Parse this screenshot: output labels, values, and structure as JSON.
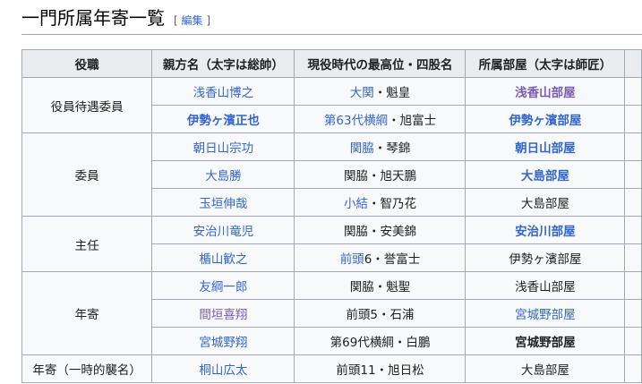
{
  "section": {
    "title": "一門所属年寄一覧",
    "edit_open": "[ ",
    "edit_label": "編集",
    "edit_close": " ]"
  },
  "table": {
    "headers": [
      "役職",
      "親方名（太字は総帥）",
      "現役時代の最高位・四股名",
      "所属部屋（太字は師匠）"
    ],
    "roles": {
      "r1": "役員待遇委員",
      "r2": "委員",
      "r3": "主任",
      "r4": "年寄",
      "r5": "年寄（一時的襲名）"
    },
    "rows": [
      {
        "name": "浅香山博之",
        "rank_link": "大関",
        "rank_rest": "・魁皇",
        "stable": "浅香山部屋"
      },
      {
        "name": "伊勢ヶ濱正也",
        "rank_link": "第63代横綱",
        "rank_rest": "・旭富士",
        "stable": "伊勢ヶ濱部屋"
      },
      {
        "name": "朝日山宗功",
        "rank_link": "関脇",
        "rank_rest": "・琴錦",
        "stable": "朝日山部屋"
      },
      {
        "name": "大島勝",
        "rank": "関脇・旭天鵬",
        "stable": "大島部屋"
      },
      {
        "name": "玉垣伸哉",
        "rank_link": "小結",
        "rank_rest": "・智乃花",
        "stable": "大島部屋"
      },
      {
        "name": "安治川竜児",
        "rank": "関脇・安美錦",
        "stable": "安治川部屋"
      },
      {
        "name": "楯山歓之",
        "rank_link": "前頭",
        "rank_rest": "6・誉富士",
        "stable": "伊勢ヶ濱部屋"
      },
      {
        "name": "友綱一郎",
        "rank": "関脇・魁聖",
        "stable": "浅香山部屋"
      },
      {
        "name": "間垣喜翔",
        "rank": "前頭5・石浦",
        "stable": "宮城野部屋"
      },
      {
        "name": "宮城野翔",
        "rank": "第69代横綱・白鵬",
        "stable": "宮城野部屋"
      },
      {
        "name": "桐山広太",
        "rank": "前頭11・旭日松",
        "stable": "大島部屋"
      }
    ]
  },
  "colors": {
    "link": "#3366cc",
    "visited": "#795cb2",
    "header_bg": "#eaecf0",
    "cell_bg": "#f8f9fa",
    "border": "#a2a9b1"
  }
}
